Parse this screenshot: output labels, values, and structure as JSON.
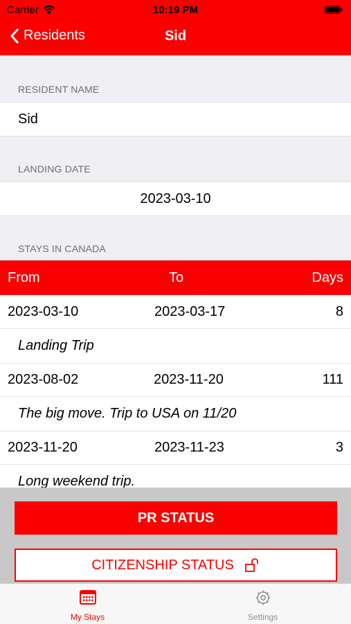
{
  "status_bar": {
    "carrier": "Carrier",
    "time": "10:19 PM"
  },
  "nav": {
    "back_label": "Residents",
    "title": "Sid"
  },
  "form": {
    "resident_name_header": "RESIDENT NAME",
    "resident_name_value": "Sid",
    "landing_date_header": "LANDING DATE",
    "landing_date_value": "2023-03-10",
    "stays_header": "STAYS IN CANADA"
  },
  "table": {
    "headers": {
      "from": "From",
      "to": "To",
      "days": "Days"
    },
    "stays": [
      {
        "from": "2023-03-10",
        "to": "2023-03-17",
        "days": "8",
        "note": "Landing Trip"
      },
      {
        "from": "2023-08-02",
        "to": "2023-11-20",
        "days": "111",
        "note": "The big move. Trip to USA on 11/20"
      },
      {
        "from": "2023-11-20",
        "to": "2023-11-23",
        "days": "3",
        "note": "Long weekend trip."
      }
    ]
  },
  "buttons": {
    "pr_status": "PR STATUS",
    "citizenship_status": "CITIZENSHIP STATUS"
  },
  "tabs": [
    {
      "label": "My Stays",
      "icon": "calendar-icon",
      "active": true
    },
    {
      "label": "Settings",
      "icon": "gear-icon",
      "active": false
    }
  ],
  "colors": {
    "accent": "#fa0000",
    "inactive_tab": "#8e8e93"
  }
}
